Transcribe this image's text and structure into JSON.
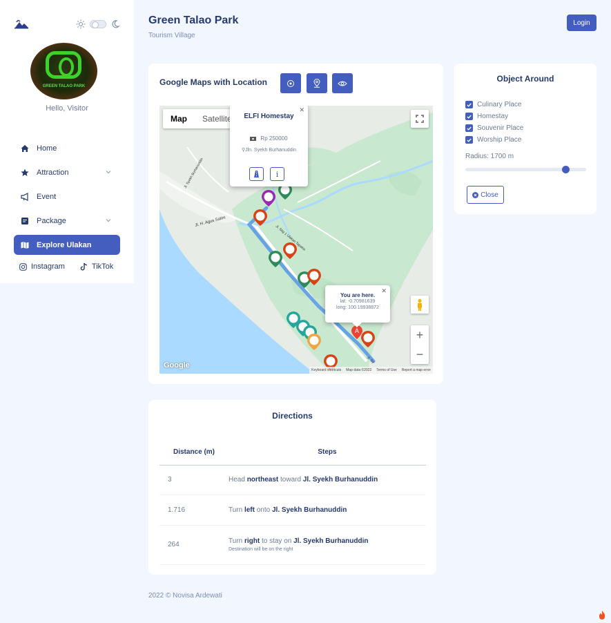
{
  "sidebar": {
    "greeting": "Hello, Visitor",
    "logo_text": "GREEN TALAO PARK",
    "menu": [
      {
        "label": "Home",
        "icon": "house-icon"
      },
      {
        "label": "Attraction",
        "icon": "star-icon",
        "has_submenu": true
      },
      {
        "label": "Event",
        "icon": "megaphone-icon"
      },
      {
        "label": "Package",
        "icon": "file-icon",
        "has_submenu": true
      },
      {
        "label": "Explore Ulakan",
        "icon": "map-icon",
        "active": true
      }
    ],
    "socials": [
      {
        "label": "Instagram",
        "icon": "instagram-icon"
      },
      {
        "label": "TikTok",
        "icon": "tiktok-icon"
      }
    ]
  },
  "header": {
    "title": "Green Talao Park",
    "subtitle": "Tourism Village",
    "login_label": "Login"
  },
  "map_card": {
    "title": "Google Maps with Location",
    "buttons": [
      "locate-icon",
      "pin-icon",
      "eye-icon"
    ],
    "map_type_tabs": [
      "Map",
      "Satellite"
    ],
    "selected_tab": "Map",
    "road_labels": [
      "Jl. H. Agus Salim",
      "Jl. Syekh Burhanuddin",
      "Jl. Sbg 1 Ulakan Tapakis",
      "Jl. Sy"
    ],
    "info_window": {
      "title": "ELFI Homestay",
      "price": "Rp 250000",
      "address": "Jln. Syekh Burhanuddin",
      "buttons": [
        "directions-icon",
        "i"
      ]
    },
    "location_window": {
      "title": "You are here.",
      "lat": "lat: -0.70981639",
      "long": "long: 100.19938872"
    },
    "marker_label": "A",
    "google_logo": "Google",
    "attribution": [
      "Keyboard shortcuts",
      "Map data ©2022",
      "Terms of Use",
      "Report a map error"
    ],
    "zoom_in": "+",
    "zoom_out": "−"
  },
  "object_around": {
    "title": "Object Around",
    "options": [
      {
        "label": "Culinary Place",
        "checked": true
      },
      {
        "label": "Homestay",
        "checked": true
      },
      {
        "label": "Souvenir Place",
        "checked": true
      },
      {
        "label": "Worship Place",
        "checked": true
      }
    ],
    "radius_label": "Radius: 1700 m",
    "radius_fraction": 0.83,
    "close_label": "Close"
  },
  "directions": {
    "title": "Directions",
    "headers": [
      "Distance (m)",
      "Steps"
    ],
    "rows": [
      {
        "distance": "3",
        "pre": "Head ",
        "b1": "northeast",
        "mid": " toward ",
        "b2": "Jl. Syekh Burhanuddin",
        "note": ""
      },
      {
        "distance": "1.716",
        "pre": "Turn ",
        "b1": "left",
        "mid": " onto ",
        "b2": "Jl. Syekh Burhanuddin",
        "note": ""
      },
      {
        "distance": "264",
        "pre": "Turn ",
        "b1": "right",
        "mid": " to stay on ",
        "b2": "Jl. Syekh Burhanuddin",
        "note": "Destination will be on the right"
      }
    ]
  },
  "footer": "2022 © Novisa Ardewati",
  "colors": {
    "primary": "#435ebe",
    "background": "#f2f7ff",
    "text": "#25396f",
    "muted": "#6c7a91"
  }
}
